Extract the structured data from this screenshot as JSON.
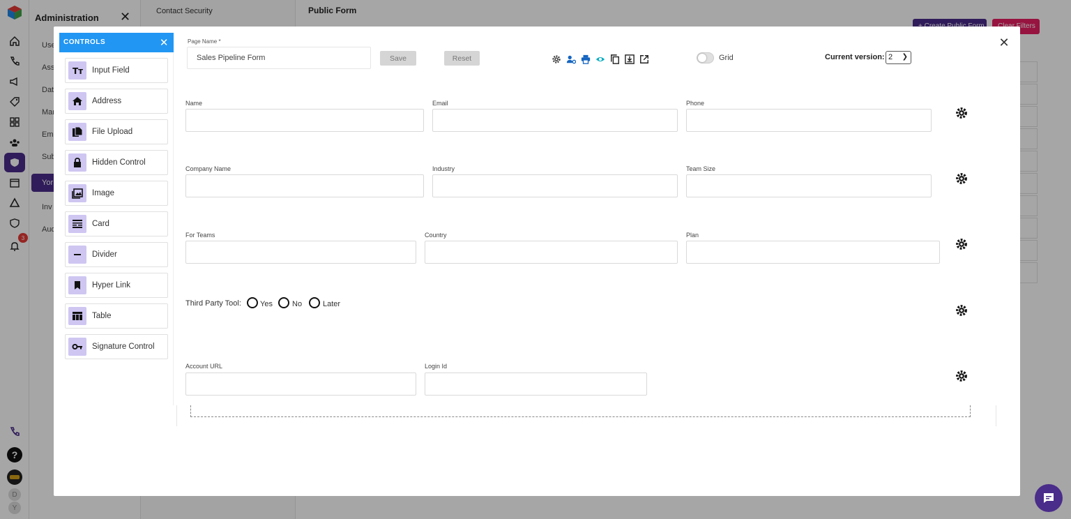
{
  "background": {
    "admin_title": "Administration",
    "admin_items": [
      "Use",
      "Ass",
      "Dat",
      "Mar",
      "Ema",
      "Sub",
      "Yor",
      "Inv",
      "Aud"
    ],
    "sub_header": "Contact Security",
    "main_title": "Public Form",
    "create_button": "+ Create Public Form",
    "clear_button": "Clear Filters",
    "notification_count": "3",
    "avatar_letters": [
      "D",
      "Y"
    ]
  },
  "controls": {
    "title": "CONTROLS",
    "items": [
      {
        "label": "Input Field",
        "icon": "text-format-icon"
      },
      {
        "label": "Address",
        "icon": "home-icon"
      },
      {
        "label": "File Upload",
        "icon": "file-copy-icon"
      },
      {
        "label": "Hidden Control",
        "icon": "lock-icon"
      },
      {
        "label": "Image",
        "icon": "image-icon"
      },
      {
        "label": "Card",
        "icon": "card-icon"
      },
      {
        "label": "Divider",
        "icon": "minus-icon"
      },
      {
        "label": "Hyper Link",
        "icon": "bookmark-icon"
      },
      {
        "label": "Table",
        "icon": "table-icon"
      },
      {
        "label": "Signature Control",
        "icon": "key-icon"
      }
    ]
  },
  "toolbar": {
    "page_name_label": "Page Name *",
    "page_name_value": "Sales Pipeline Form",
    "save_label": "Save",
    "reset_label": "Reset",
    "grid_label": "Grid",
    "grid_on": false,
    "version_label": "Current version:",
    "version_value": "2",
    "tools": [
      "settings-icon",
      "manage-accounts-icon",
      "print-icon",
      "preview-eye-icon",
      "copy-icon",
      "download-icon",
      "open-external-icon"
    ]
  },
  "form": {
    "rows": [
      [
        "Name",
        "Email",
        "Phone"
      ],
      [
        "Company Name",
        "Industry",
        "Team Size"
      ],
      [
        "For Teams",
        "Country",
        "Plan"
      ],
      [
        "Account URL",
        "Login Id"
      ]
    ],
    "radio_group": {
      "label": "Third Party Tool:",
      "options": [
        "Yes",
        "No",
        "Later"
      ]
    }
  },
  "colors": {
    "accent": "#2196f3",
    "brand": "#4a2c8a",
    "danger": "#e91e63",
    "icon_tile": "#cfc6f2"
  }
}
